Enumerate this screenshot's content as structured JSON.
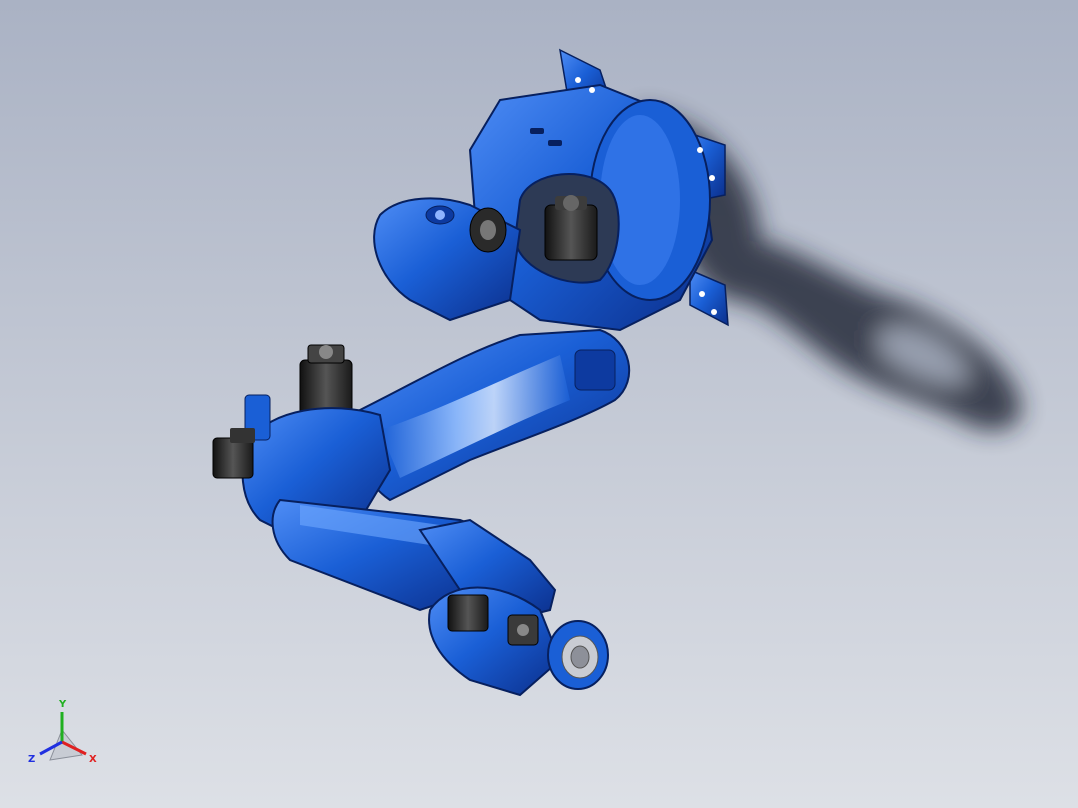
{
  "viewport": {
    "background_top": "#aab2c4",
    "background_bottom": "#dde0e6"
  },
  "model": {
    "body_color": "#1a5fd6",
    "body_dark": "#0b2e8a",
    "highlight": "#6fa8ff",
    "motor_color": "#2a2a2a",
    "shadow_color": "#1e2230"
  },
  "triad": {
    "x_label": "X",
    "y_label": "Y",
    "z_label": "Z",
    "x_color": "#e02020",
    "y_color": "#20b020",
    "z_color": "#2030e0"
  }
}
